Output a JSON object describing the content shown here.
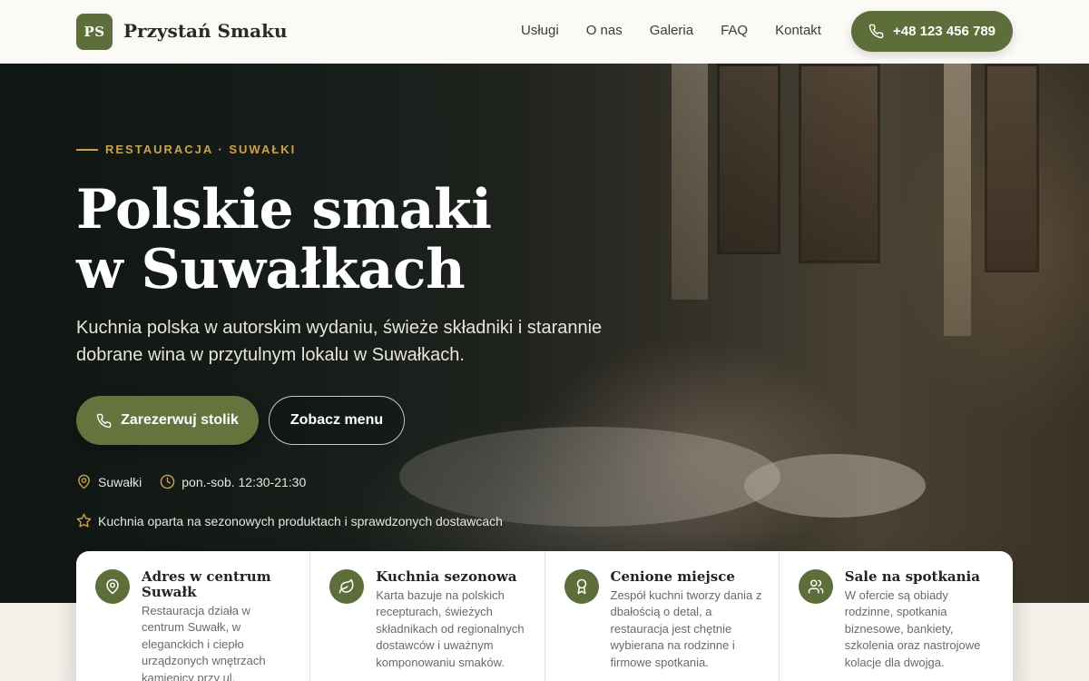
{
  "header": {
    "logo": "PS",
    "brand": "Przystań Smaku",
    "nav": [
      "Usługi",
      "O nas",
      "Galeria",
      "FAQ",
      "Kontakt"
    ],
    "phone": "+48 123 456 789"
  },
  "hero": {
    "eyebrow": "RESTAURACJA · SUWAŁKI",
    "title_line1": "Polskie smaki",
    "title_line2": "w Suwałkach",
    "lead": "Kuchnia polska w autorskim wydaniu, świeże składniki i starannie dobrane wina w przytulnym lokalu w Suwałkach.",
    "cta_primary": "Zarezerwuj stolik",
    "cta_secondary": "Zobacz menu",
    "location": "Suwałki",
    "hours": "pon.-sob. 12:30-21:30",
    "note": "Kuchnia oparta na sezonowych produktach i sprawdzonych dostawcach"
  },
  "features": [
    {
      "title": "Adres w centrum Suwałk",
      "text": "Restauracja działa w centrum Suwałk, w eleganckich i ciepło urządzonych wnętrzach kamienicy przy ul.",
      "icon": "location-pin-icon"
    },
    {
      "title": "Kuchnia sezonowa",
      "text": "Karta bazuje na polskich recepturach, świeżych składnikach od regionalnych dostawców i uważnym komponowaniu smaków.",
      "icon": "leaf-icon"
    },
    {
      "title": "Cenione miejsce",
      "text": "Zespół kuchni tworzy dania z dbałością o detal, a restauracja jest chętnie wybierana na rodzinne i firmowe spotkania.",
      "icon": "award-icon"
    },
    {
      "title": "Sale na spotkania",
      "text": "W ofercie są obiady rodzinne, spotkania biznesowe, bankiety, szkolenia oraz nastrojowe kolacje dla dwojga.",
      "icon": "users-icon"
    }
  ],
  "colors": {
    "accent": "#5e6e3a",
    "gold": "#c9a24e"
  }
}
